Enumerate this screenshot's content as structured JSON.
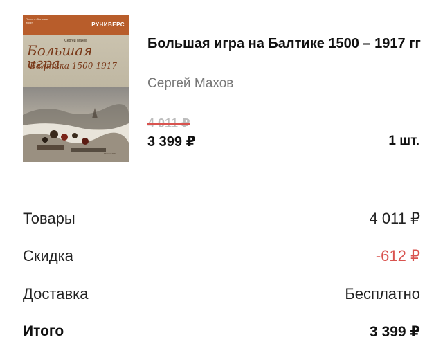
{
  "cart_item": {
    "cover": {
      "series_note": "Проект «Большая игра»",
      "brand": "РУНИВЕРС",
      "author": "Сергей Махов",
      "title": "Большая игра",
      "subtitle": "Балтика 1500-1917",
      "publisher": "Москва 2016"
    },
    "title": "Большая игра на Балтике 1500 – 1917 гг",
    "author": "Сергей Махов",
    "old_price": "4 011 ₽",
    "price": "3 399 ₽",
    "quantity": "1 шт."
  },
  "summary": {
    "rows": [
      {
        "label": "Товары",
        "value": "4 011 ₽"
      },
      {
        "label": "Скидка",
        "value": "-612 ₽"
      },
      {
        "label": "Доставка",
        "value": "Бесплатно"
      },
      {
        "label": "Итого",
        "value": "3 399 ₽"
      }
    ]
  },
  "colors": {
    "discount": "#d9534f",
    "secondary_text": "#777777",
    "strike_price": "#bdbdbd"
  }
}
